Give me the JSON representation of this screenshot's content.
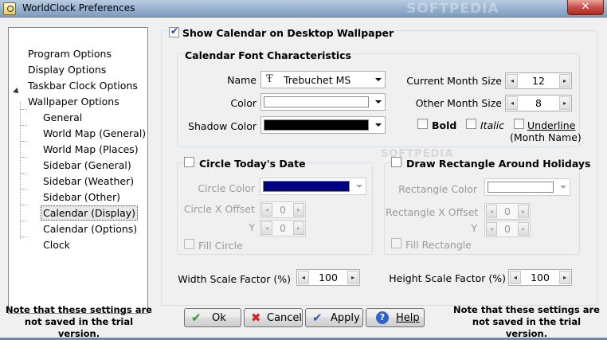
{
  "window": {
    "title": "WorldClock Preferences",
    "close_glyph": "✕"
  },
  "tree": {
    "items": [
      {
        "label": "Program Options"
      },
      {
        "label": "Display Options"
      },
      {
        "label": "Taskbar Clock Options"
      },
      {
        "label": "Wallpaper Options"
      },
      {
        "label": "General"
      },
      {
        "label": "World Map (General)"
      },
      {
        "label": "World Map (Places)"
      },
      {
        "label": "Sidebar (General)"
      },
      {
        "label": "Sidebar (Weather)"
      },
      {
        "label": "Sidebar (Other)"
      },
      {
        "label": "Calendar (Display)"
      },
      {
        "label": "Calendar (Options)"
      },
      {
        "label": "Clock"
      }
    ],
    "selected": "Calendar (Display)"
  },
  "notes": {
    "left": "Note that these settings are not saved in the trial version.",
    "right": "Note that these settings are not saved in the trial version."
  },
  "main": {
    "show_calendar": {
      "label": "Show Calendar on Desktop Wallpaper",
      "checked": true
    },
    "font_group": {
      "title": "Calendar Font Characteristics",
      "name_label": "Name",
      "name_value": "Trebuchet MS",
      "font_glyph": "Ŧ",
      "color_label": "Color",
      "color_value": "#ffffff",
      "shadow_label": "Shadow Color",
      "shadow_value": "#000000",
      "current_month_label": "Current Month Size",
      "current_month_value": "12",
      "other_month_label": "Other Month Size",
      "other_month_value": "8",
      "bold_label": "Bold",
      "italic_label": "Italic",
      "underline_label": "Underline",
      "month_name_note": "(Month Name)"
    },
    "circle_group": {
      "title": "Circle Today's Date",
      "color_label": "Circle Color",
      "color_value": "#000080",
      "x_offset_label": "Circle X Offset",
      "x_offset_value": "0",
      "y_label": "Y",
      "y_value": "0",
      "fill_label": "Fill Circle"
    },
    "rect_group": {
      "title": "Draw Rectangle Around Holidays",
      "color_label": "Rectangle Color",
      "color_value": "#ffffff",
      "x_offset_label": "Rectangle X Offset",
      "x_offset_value": "0",
      "y_label": "Y",
      "y_value": "0",
      "fill_label": "Fill Rectangle"
    },
    "width_scale": {
      "label": "Width Scale Factor (%)",
      "value": "100"
    },
    "height_scale": {
      "label": "Height Scale Factor (%)",
      "value": "100"
    }
  },
  "buttons": {
    "ok": "Ok",
    "cancel": "Cancel",
    "apply": "Apply",
    "help": "Help"
  },
  "spin_glyphs": {
    "left": "◂",
    "right": "▸"
  },
  "watermark": {
    "text": "SOFTPEDIA"
  }
}
